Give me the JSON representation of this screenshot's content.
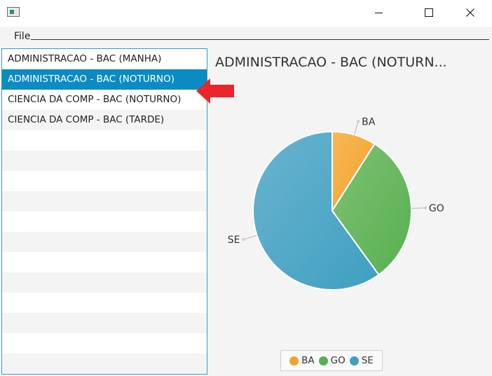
{
  "window": {
    "title": "",
    "minimize_icon": "minimize-icon",
    "maximize_icon": "maximize-icon",
    "close_icon": "close-icon"
  },
  "menubar": {
    "file_label": "File"
  },
  "list": {
    "items": [
      "ADMINISTRACAO - BAC (MANHA)",
      "ADMINISTRACAO - BAC (NOTURNO)",
      "CIENCIA DA COMP - BAC (NOTURNO)",
      "CIENCIA DA COMP - BAC (TARDE)"
    ],
    "selected_index": 1
  },
  "chart": {
    "title": "ADMINISTRACAO - BAC (NOTURN..."
  },
  "chart_data": {
    "type": "pie",
    "labels": [
      "BA",
      "GO",
      "SE"
    ],
    "values": [
      9,
      31,
      60
    ],
    "colors": [
      "#f3a329",
      "#58b04f",
      "#3f9fc1"
    ],
    "legend_position": "bottom"
  },
  "annotation": {
    "arrow_color": "#e8262b"
  }
}
